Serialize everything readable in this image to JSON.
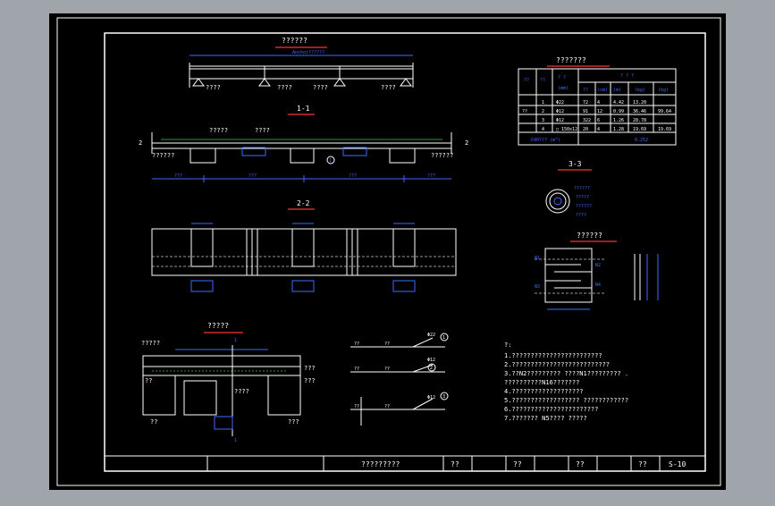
{
  "colors": {
    "chrome_bg": "#a0a4ab",
    "paper": "#000000",
    "line": "#ffffff",
    "dim": "#3d6bff",
    "accent": "#ff3030",
    "hidden": "#c8c8c8",
    "green": "#29d633"
  },
  "titles": {
    "plan": "??????",
    "section_11": "1-1",
    "section_22": "2-2",
    "section_33": "3-3",
    "table": "???????",
    "detail": "?????",
    "joint": "??????"
  },
  "plan": {
    "dim_text": "Anchor??????",
    "labels": [
      "????",
      "????",
      "????",
      "????"
    ]
  },
  "section_11": {
    "side_mark": "2",
    "label_left": "??????",
    "label_mid": "?????",
    "label_mid2": "????",
    "label_right": "??????",
    "circle_mark": "1",
    "box_labels": [
      "??????",
      "?????",
      "??????"
    ],
    "dims": [
      "???",
      "???",
      "???",
      "???",
      "???"
    ]
  },
  "table": {
    "headers": [
      "??",
      "??",
      "? ?",
      "? ? ?"
    ],
    "subheaders": [
      "(mm)",
      "??",
      "(cm)",
      "(m)",
      "(kg)",
      "(kg)"
    ],
    "rows": [
      [
        "",
        "1",
        "Φ22",
        "72",
        "4",
        "4.42",
        "13.20",
        ""
      ],
      [
        "??",
        "2",
        "Φ12",
        "91",
        "12",
        "0.99",
        "36.46",
        "99.64"
      ],
      [
        "",
        "3",
        "Φ12",
        "322",
        "6",
        "1.26",
        "28.78",
        ""
      ],
      [
        "",
        "4",
        "□ 150x12",
        "20",
        "4",
        "1.28",
        "19.69",
        "19.69"
      ]
    ],
    "footer_label": "C40??? (m³)",
    "footer_value": "0.252"
  },
  "section_33": {
    "labels": [
      "??????",
      "?????",
      "??????",
      "????"
    ]
  },
  "joint": {
    "left_labels": [
      "N1",
      "N3"
    ],
    "right_labels": [
      "N2",
      "N4"
    ],
    "dims": [
      "?",
      "?"
    ]
  },
  "detail": {
    "labels": [
      "?????",
      "???",
      "???",
      "??",
      "????",
      "???",
      "??"
    ],
    "marks": [
      "1",
      "1"
    ]
  },
  "rebars": [
    {
      "mark": "1",
      "spec": "Φ22",
      "len_left": "??",
      "len_right": "??"
    },
    {
      "mark": "2",
      "spec": "Φ12",
      "len_left": "??",
      "len_right": "??"
    },
    {
      "mark": "3",
      "spec": "Φ12",
      "len_left": "??",
      "len_right": "??"
    }
  ],
  "notes": {
    "heading": "?:",
    "items": [
      "1.????????????????????????",
      "2.??????????????????????????",
      "3.??N2?????????          ????N1????????? .",
      "  ??????????N16???????",
      "4.???????????????????",
      "5.??????????????????  ????????????",
      "6.???????????????????????",
      "7.???????  N5????       ?????"
    ]
  },
  "titleblock": {
    "drawing_title": "?????????",
    "cells": [
      "??",
      "??",
      "??",
      "??"
    ],
    "sheet_no": "S-10"
  }
}
